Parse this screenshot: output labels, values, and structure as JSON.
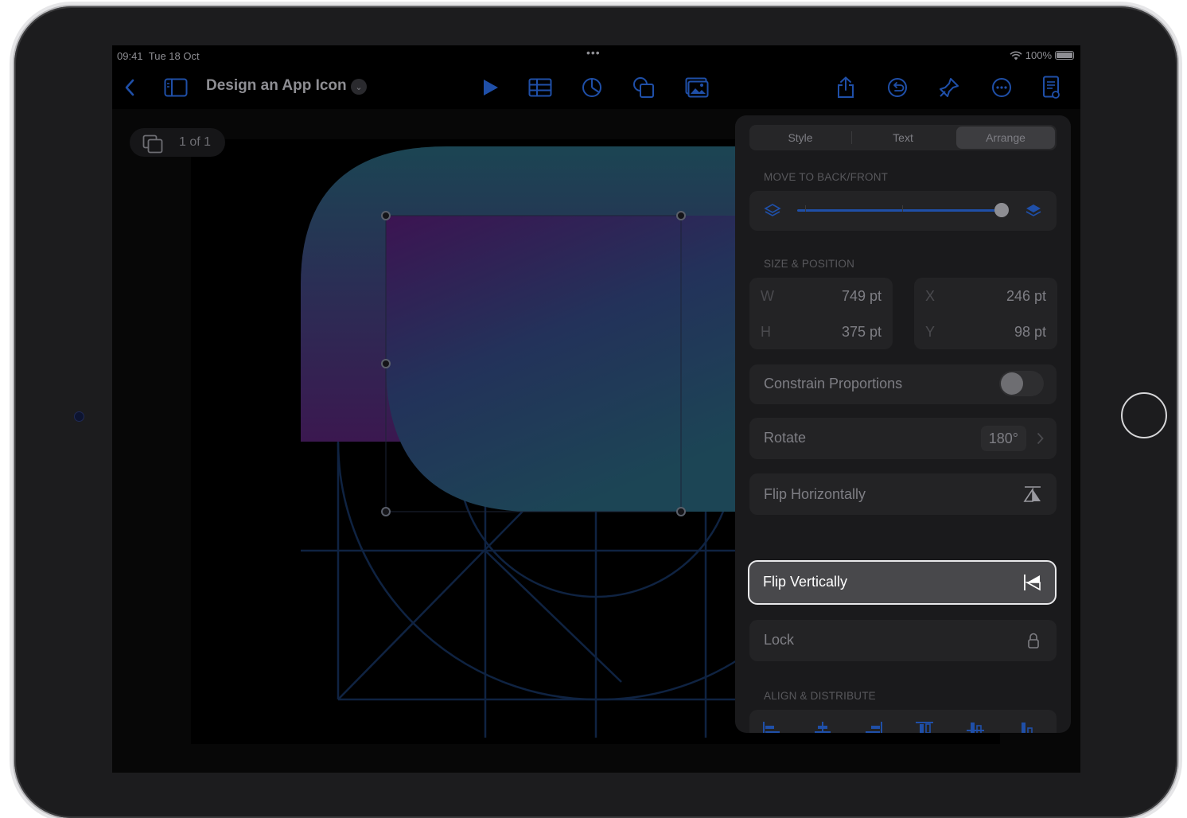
{
  "status": {
    "time": "09:41",
    "date": "Tue 18 Oct",
    "battery": "100%"
  },
  "toolbar": {
    "doc_title": "Design an App Icon",
    "icons": [
      "back-chevron-icon",
      "sidebar-icon",
      "play-icon",
      "table-icon",
      "chart-icon",
      "shape-icon",
      "media-icon",
      "share-icon",
      "undo-icon",
      "format-brush-icon",
      "more-icon",
      "document-icon"
    ]
  },
  "canvas": {
    "page_indicator": "1 of 1"
  },
  "panel": {
    "tabs": [
      "Style",
      "Text",
      "Arrange"
    ],
    "selected_tab": "Arrange",
    "move_section": "MOVE TO BACK/FRONT",
    "layer_slider_value": 1.0,
    "size_section": "SIZE & POSITION",
    "size": {
      "w_label": "W",
      "w_value": "749 pt",
      "h_label": "H",
      "h_value": "375 pt"
    },
    "position": {
      "x_label": "X",
      "x_value": "246 pt",
      "y_label": "Y",
      "y_value": "98 pt"
    },
    "constrain_label": "Constrain Proportions",
    "constrain_on": false,
    "rotate_label": "Rotate",
    "rotate_value": "180°",
    "flip_h_label": "Flip Horizontally",
    "flip_v_label": "Flip Vertically",
    "lock_label": "Lock",
    "align_section": "ALIGN & DISTRIBUTE",
    "align_icons": [
      "align-left-icon",
      "align-center-icon",
      "align-right-icon",
      "align-top-icon",
      "align-middle-icon",
      "align-bottom-icon"
    ]
  },
  "colors": {
    "accent": "#1f4fa8",
    "panel_bg": "#1a1a1c",
    "card_bg": "#232325",
    "highlight_border": "#e9e9eb"
  }
}
